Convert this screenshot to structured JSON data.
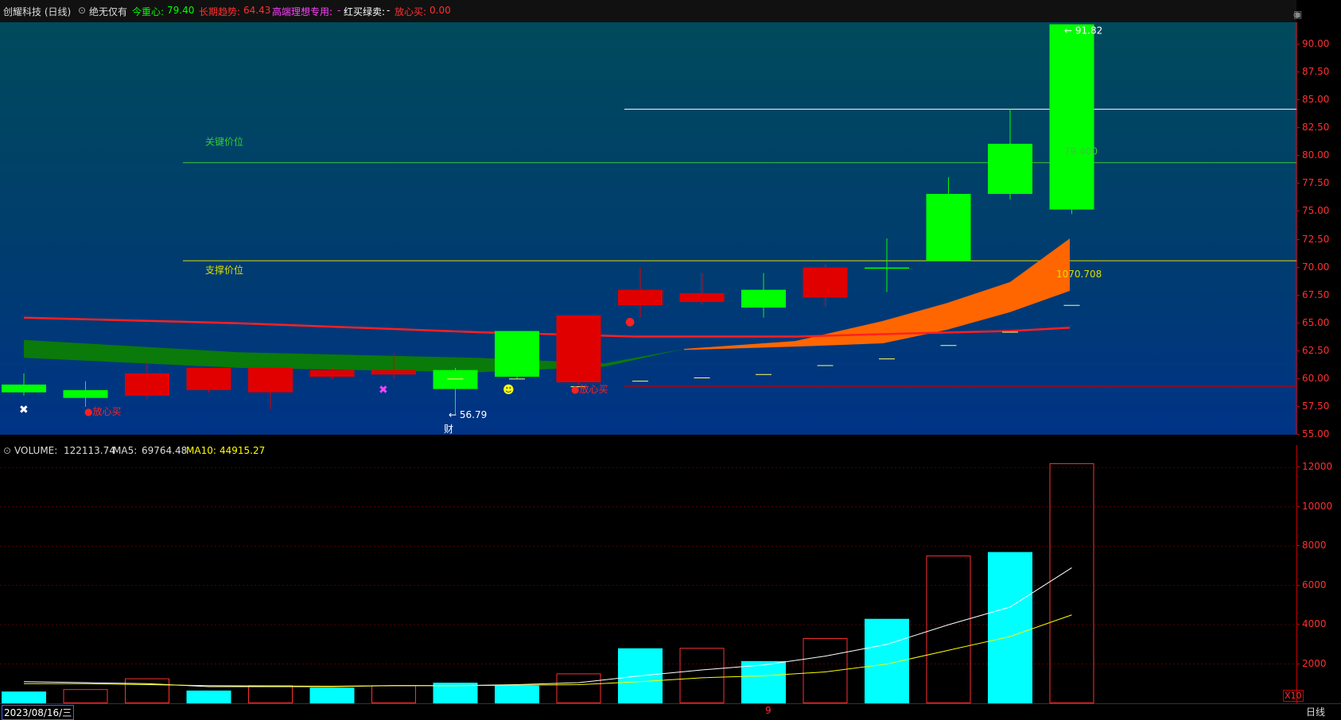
{
  "header": {
    "title": "创耀科技 (日线)",
    "indicator_name": "绝无仅有",
    "center_label": "今重心:",
    "center_value": "79.40",
    "trend_label": "长期趋势:",
    "trend_value": "64.43",
    "special_label": "高端理想专用:",
    "special_value": "-",
    "redbuy_label": "红买绿卖:",
    "redbuy_value": "-",
    "safe_label": "放心买:",
    "safe_value": "0.00"
  },
  "colors": {
    "bg_top": "#004a5c",
    "bg_bottom": "#003386",
    "up_green": "#00ff00",
    "down_red": "#e00000",
    "key_line": "#33cc33",
    "support_line": "#dddd00",
    "trend_red": "#ff2020",
    "orange_band": "#ff6600",
    "green_band": "#0a7a0a",
    "volume_cyan": "#00ffff",
    "ma5": "#ffffff",
    "ma10": "#ffff00"
  },
  "annotations": {
    "key_price": "关键价位",
    "support_price": "支撑价位",
    "max_label": "91.82",
    "min_label": "56.79",
    "center_value_label": "79.400",
    "support_value_label": "1070.708",
    "buy_signal": "●放心买",
    "finance_mark": "财"
  },
  "price_axis": {
    "ticks": [
      "90.00",
      "87.50",
      "85.00",
      "82.50",
      "80.00",
      "77.50",
      "75.00",
      "72.50",
      "70.00",
      "67.50",
      "65.00",
      "62.50",
      "60.00",
      "57.50",
      "55.00"
    ]
  },
  "volume": {
    "label": "VOLUME:",
    "value": "122113.74",
    "ma5_label": "MA5:",
    "ma5_value": "69764.48",
    "ma10_label": "MA10:",
    "ma10_value": "44915.27",
    "ticks": [
      "12000",
      "10000",
      "8000",
      "6000",
      "4000",
      "2000"
    ],
    "unit": "X10"
  },
  "footer": {
    "date": "2023/08/16/三",
    "mid_mark": "9",
    "period": "日线"
  },
  "chart_data": {
    "type": "candlestick",
    "ylim": [
      55,
      92
    ],
    "candles": [
      {
        "open": 58.8,
        "close": 59.5,
        "high": 60.5,
        "low": 58.5,
        "dir": "up"
      },
      {
        "open": 58.3,
        "close": 59.0,
        "high": 59.8,
        "low": 57.5,
        "dir": "up"
      },
      {
        "open": 60.5,
        "close": 58.5,
        "high": 61.5,
        "low": 58.2,
        "dir": "down"
      },
      {
        "open": 61.0,
        "close": 59.0,
        "high": 61.0,
        "low": 58.8,
        "dir": "down"
      },
      {
        "open": 61.0,
        "close": 58.8,
        "high": 61.0,
        "low": 57.3,
        "dir": "down"
      },
      {
        "open": 60.8,
        "close": 60.2,
        "high": 61.0,
        "low": 60.0,
        "dir": "down"
      },
      {
        "open": 60.8,
        "close": 60.4,
        "high": 62.3,
        "low": 60.0,
        "dir": "down"
      },
      {
        "open": 60.8,
        "close": 59.1,
        "high": 61.0,
        "low": 56.8,
        "dir": "up"
      },
      {
        "open": 60.2,
        "close": 64.3,
        "high": 64.3,
        "low": 60.0,
        "dir": "up"
      },
      {
        "open": 65.7,
        "close": 59.7,
        "high": 65.7,
        "low": 59.5,
        "dir": "down"
      },
      {
        "open": 68.0,
        "close": 66.6,
        "high": 70.0,
        "low": 65.5,
        "dir": "down"
      },
      {
        "open": 67.7,
        "close": 66.9,
        "high": 69.5,
        "low": 66.7,
        "dir": "down"
      },
      {
        "open": 68.0,
        "close": 66.4,
        "high": 69.5,
        "low": 65.5,
        "dir": "up"
      },
      {
        "open": 70.0,
        "close": 67.3,
        "high": 70.3,
        "low": 66.5,
        "dir": "down"
      },
      {
        "open": 70.0,
        "close": 70.0,
        "high": 72.6,
        "low": 67.8,
        "dir": "up"
      },
      {
        "open": 70.6,
        "close": 76.6,
        "high": 78.1,
        "low": 70.6,
        "dir": "up"
      },
      {
        "open": 76.6,
        "close": 81.1,
        "high": 84.2,
        "low": 76.1,
        "dir": "up"
      },
      {
        "open": 75.2,
        "close": 91.82,
        "high": 91.82,
        "low": 74.8,
        "dir": "up"
      }
    ],
    "volumes": [
      600,
      700,
      1250,
      650,
      900,
      800,
      900,
      1050,
      900,
      1500,
      2800,
      2800,
      2150,
      3300,
      4300,
      7500,
      7700,
      12200
    ],
    "volume_dir": [
      "up",
      "down",
      "down",
      "up",
      "down",
      "up",
      "down",
      "up",
      "up",
      "down",
      "up",
      "down",
      "up",
      "down",
      "up",
      "down",
      "up",
      "down"
    ],
    "ma5": [
      1100,
      1050,
      1000,
      850,
      850,
      850,
      900,
      900,
      950,
      1050,
      1400,
      1700,
      1950,
      2400,
      3000,
      4000,
      4900,
      6900
    ],
    "ma10": [
      1000,
      1000,
      950,
      900,
      880,
      870,
      900,
      900,
      920,
      950,
      1100,
      1300,
      1400,
      1600,
      2000,
      2700,
      3400,
      4500
    ],
    "volume_ylim": [
      0,
      12500
    ]
  }
}
